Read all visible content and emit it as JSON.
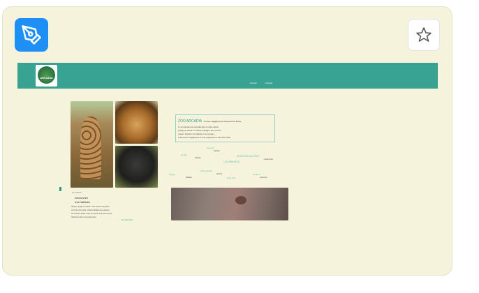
{
  "app": {
    "icon": "pen-tool-icon",
    "favorite_icon": "star-icon",
    "accent": "#1e90f5"
  },
  "site": {
    "header_color": "#38a393",
    "logo_text": "ARCADIA",
    "nav_links": [
      "Accueil",
      "Contact"
    ]
  },
  "intro": {
    "small_label": "Accueil",
    "title": "ZOO ARCADIA",
    "tagline": "Un lieu magique pour découvrir la faune",
    "lines": [
      "Le zoo Arcadia vous accueille dans un cadre naturel",
      "protégé où animaux et visiteurs partagent des moments",
      "uniques. Explorez nos habitats et nos services,",
      "et découvrez l'engagement de notre équipe pour le bien-être animal."
    ]
  },
  "sections": [
    {
      "heading": "Savane",
      "sub": "habitats"
    },
    {
      "heading": "Jungle",
      "sub": "habitats"
    },
    {
      "heading": "LES ANIMAUX",
      "sub": ""
    },
    {
      "heading": "SERVICES DU ZOO",
      "sub": "restauration"
    },
    {
      "heading": "Marais",
      "sub": "habitats"
    },
    {
      "heading": "Visite guidée",
      "sub": "gratuite"
    },
    {
      "heading": "Petit train",
      "sub": ""
    },
    {
      "heading": "Horaires",
      "sub": "ouverture"
    }
  ],
  "bottom_text": {
    "label": "Nos habitats",
    "heading_line1": "Découvrez",
    "heading_line2": "nos habitats",
    "lines": [
      "Savane, jungle et marais : trois univers à explorer",
      "au fil de votre visite, chacun abritant des espèces",
      "venues des quatre coins du monde. Prenez le temps",
      "d'observer leurs comportements."
    ],
    "link": "En savoir plus"
  }
}
